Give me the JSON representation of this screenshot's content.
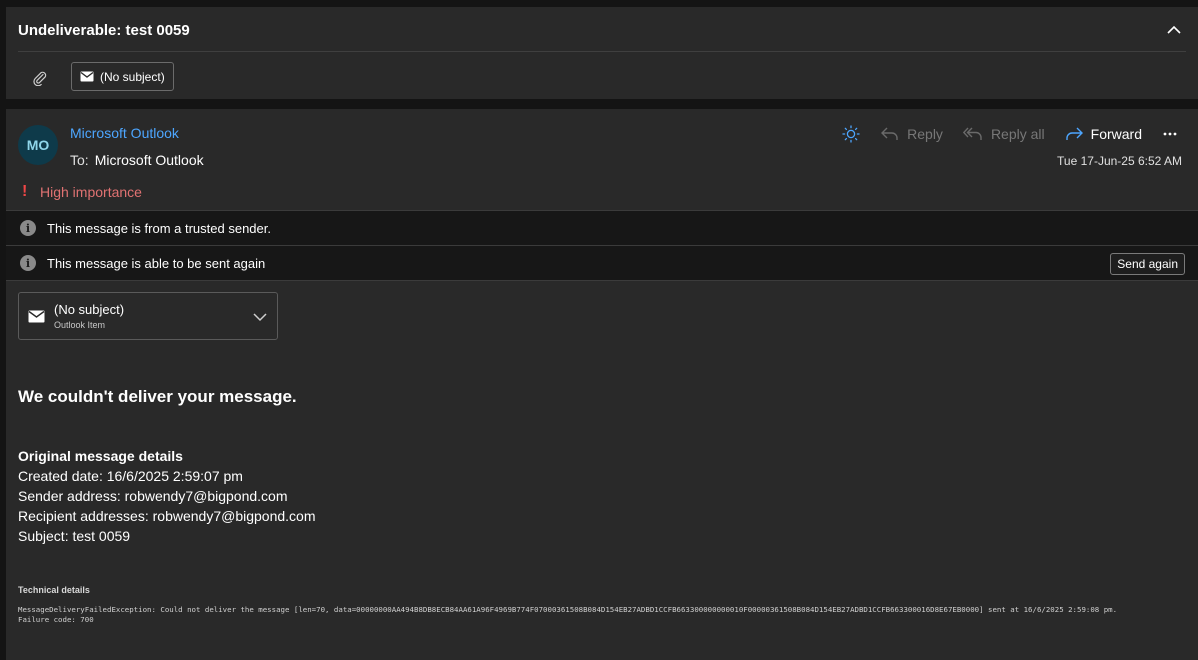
{
  "subject": {
    "title": "Undeliverable: test 0059",
    "attachment_chip": "(No subject)"
  },
  "message": {
    "avatar_initials": "MO",
    "sender": "Microsoft Outlook",
    "to_label": "To:",
    "to": "Microsoft Outlook",
    "date": "Tue 17-Jun-25 6:52 AM",
    "importance": "High importance",
    "actions": {
      "reply": "Reply",
      "reply_all": "Reply all",
      "forward": "Forward"
    }
  },
  "info_bars": {
    "trusted": "This message is from a trusted sender.",
    "resend": "This message is able to be sent again",
    "send_again_button": "Send again"
  },
  "attached_item": {
    "title": "(No subject)",
    "subtitle": "Outlook Item"
  },
  "body": {
    "headline": "We couldn't deliver your message.",
    "details_title": "Original message details",
    "created": "Created date: 16/6/2025 2:59:07 pm",
    "sender": "Sender address: robwendy7@bigpond.com",
    "recipients": "Recipient addresses: robwendy7@bigpond.com",
    "subject": "Subject: test 0059",
    "technical_title": "Technical details",
    "technical_line1": "MessageDeliveryFailedException: Could not deliver the message [len=70, data=00000000AA494B8DB8ECB84AA61A96F4969B774F07000361508B084D154EB27ADBD1CCFB663300000000010F00000361508B084D154EB27ADBD1CCFB663300016D8E67EB0000] sent at 16/6/2025 2:59:08 pm.",
    "technical_line2": "Failure code: 700"
  },
  "colors": {
    "accent": "#4da6ff",
    "importance": "#e07272",
    "background": "#292929"
  }
}
